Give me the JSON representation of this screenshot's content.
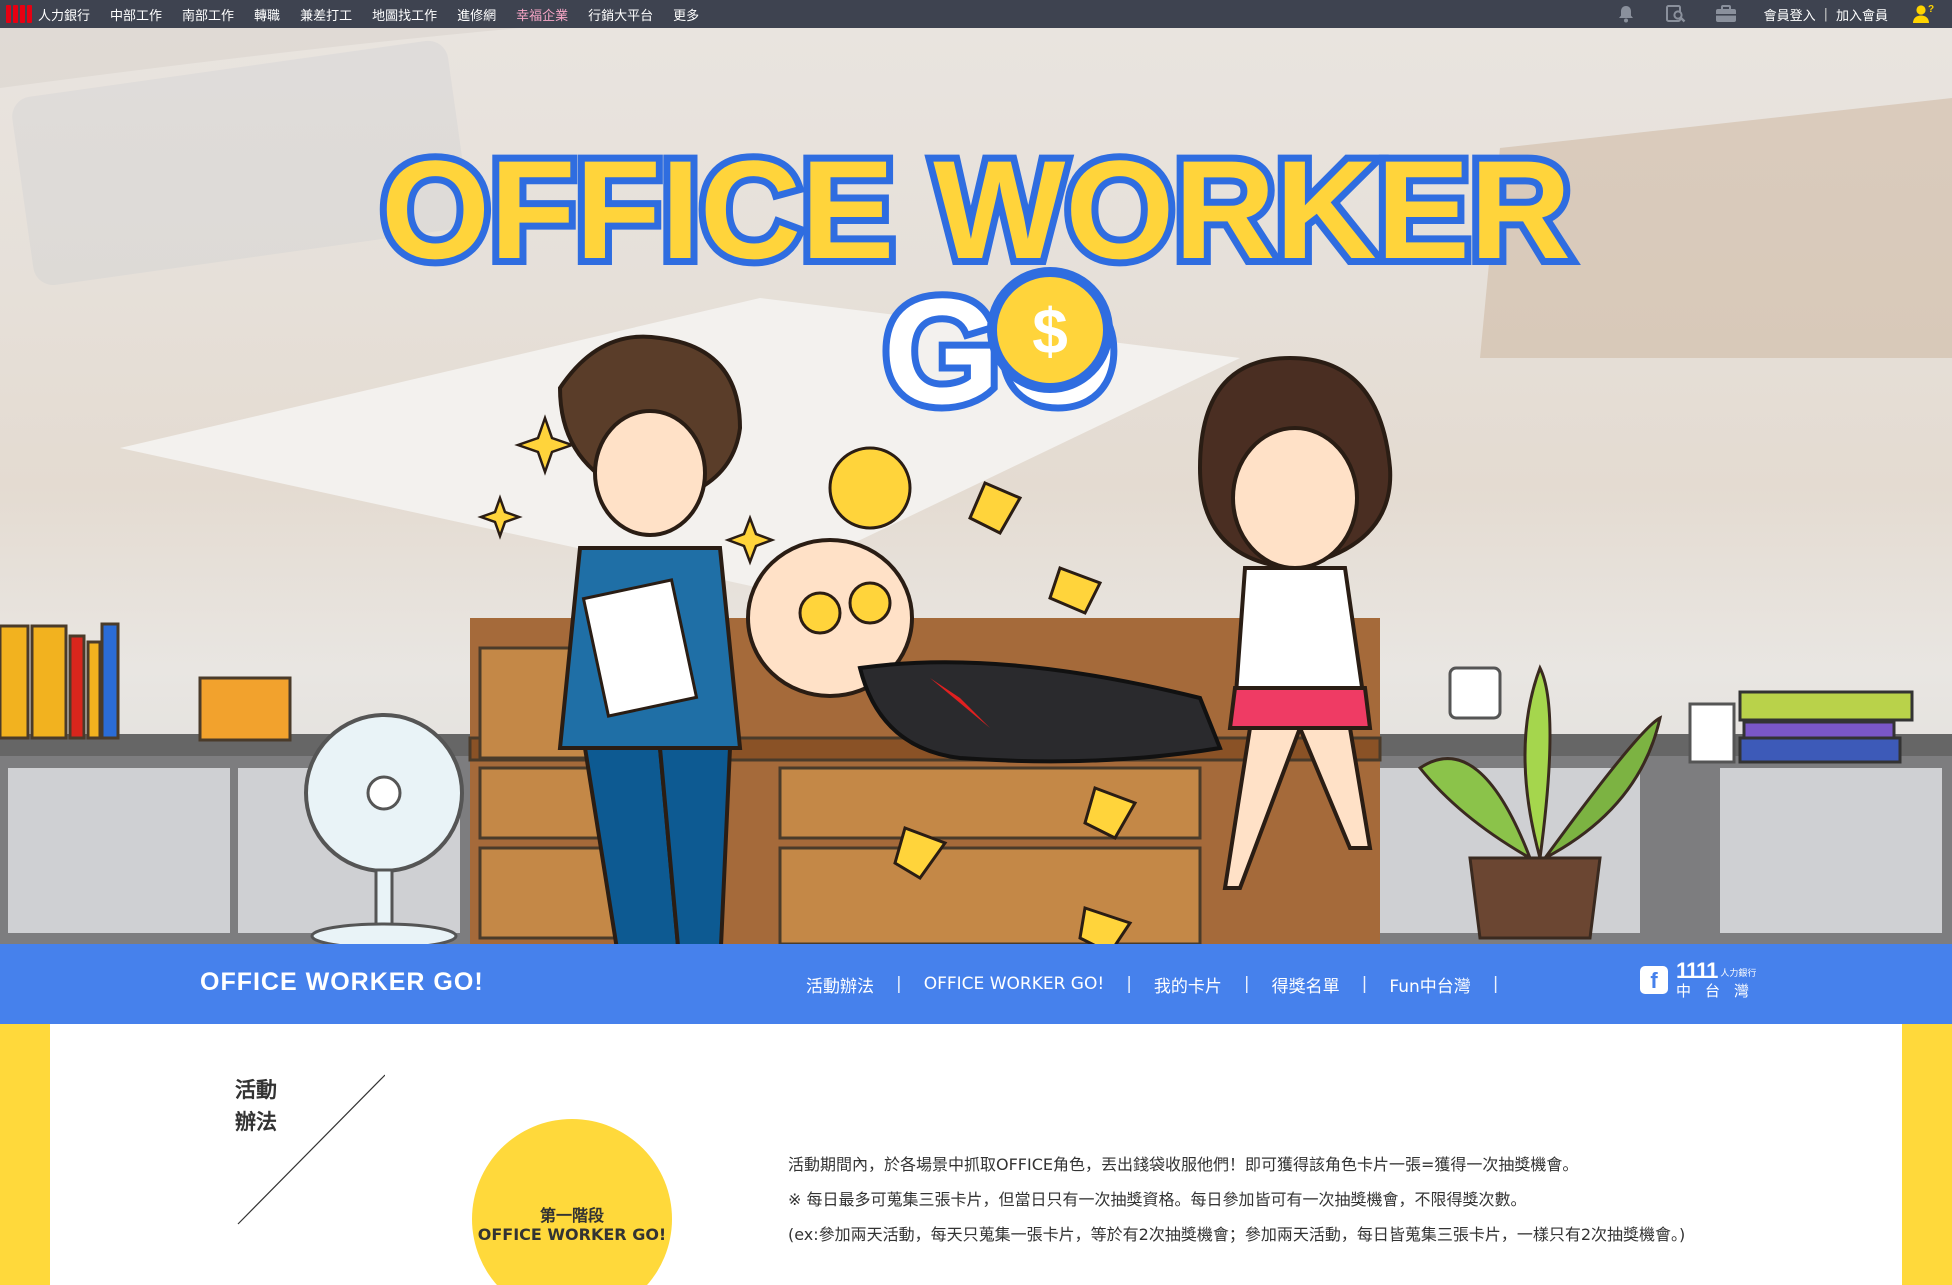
{
  "topbar": {
    "logo_text": "人力銀行",
    "nav": [
      "中部工作",
      "南部工作",
      "轉職",
      "兼差打工",
      "地圖找工作",
      "進修網",
      "幸福企業",
      "行銷大平台",
      "更多"
    ],
    "member_login": "會員登入",
    "separator": "|",
    "join_member": "加入會員",
    "icons": [
      "bell-icon",
      "search-doc-icon",
      "briefcase-icon",
      "user-help-icon"
    ]
  },
  "hero": {
    "title_line1": "OFFICE WORKER",
    "title_line2": "GO"
  },
  "bandnav": {
    "logo": "OFFICE WORKER GO!",
    "menu": [
      "活動辦法",
      "OFFICE WORKER GO!",
      "我的卡片",
      "得獎名單",
      "Fun中台灣"
    ],
    "menu_separator": "|",
    "brand_number": "1111",
    "brand_small": "人力銀行",
    "brand_region": "中台灣"
  },
  "content": {
    "section_title_1": "活動",
    "section_title_2": "辦法",
    "stage_label": "第一階段",
    "stage_name": "OFFICE WORKER GO!",
    "desc": [
      "活動期間內，於各場景中抓取OFFICE角色，丟出錢袋收服他們！即可獲得該角色卡片一張=獲得一次抽獎機會。",
      "※ 每日最多可蒐集三張卡片，但當日只有一次抽獎資格。每日參加皆可有一次抽獎機會，不限得獎次數。",
      "(ex:參加兩天活動，每天只蒐集一張卡片，等於有2次抽獎機會；參加兩天活動，每日皆蒐集三張卡片，一樣只有2次抽獎機會。)"
    ]
  },
  "colors": {
    "topbar_bg": "#3e4350",
    "band_blue": "#4681ec",
    "accent_yellow": "#ffd93b",
    "brand_red": "#e60012"
  }
}
